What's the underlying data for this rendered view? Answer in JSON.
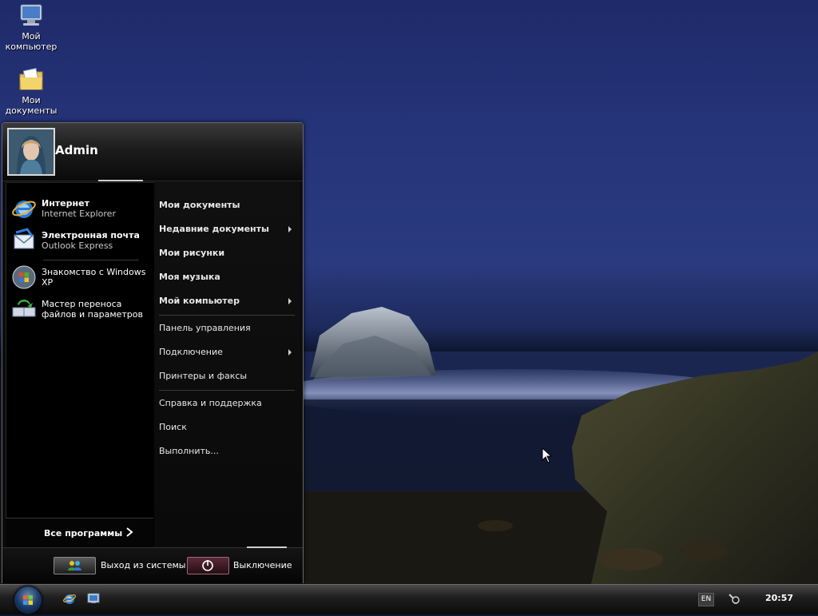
{
  "desktop": {
    "icons": [
      {
        "label": "Мой компьютер",
        "icon": "computer-icon"
      },
      {
        "label": "Мои документы",
        "icon": "documents-folder-icon"
      }
    ]
  },
  "start_menu": {
    "user": {
      "name": "Admin",
      "avatar": "user-avatar"
    },
    "pinned": [
      {
        "title": "Интернет",
        "subtitle": "Internet Explorer",
        "icon": "internet-explorer-icon"
      },
      {
        "title": "Электронная почта",
        "subtitle": "Outlook Express",
        "icon": "outlook-express-icon"
      }
    ],
    "recent": [
      {
        "label": "Знакомство с Windows XP",
        "icon": "windows-tour-icon"
      },
      {
        "label": "Мастер переноса файлов и параметров",
        "icon": "transfer-wizard-icon"
      }
    ],
    "all_programs_label": "Все программы",
    "right_items": [
      {
        "label": "Мои документы",
        "bold": true,
        "arrow": false
      },
      {
        "label": "Недавние документы",
        "bold": true,
        "arrow": true
      },
      {
        "label": "Мои рисунки",
        "bold": true,
        "arrow": false
      },
      {
        "label": "Моя музыка",
        "bold": true,
        "arrow": false
      },
      {
        "label": "Мой компьютер",
        "bold": true,
        "arrow": true
      },
      {
        "label": "Панель управления",
        "bold": false,
        "arrow": false
      },
      {
        "label": "Подключение",
        "bold": false,
        "arrow": true
      },
      {
        "label": "Принтеры и факсы",
        "bold": false,
        "arrow": false
      },
      {
        "label": "Справка и поддержка",
        "bold": false,
        "arrow": false
      },
      {
        "label": "Поиск",
        "bold": false,
        "arrow": false
      },
      {
        "label": "Выполнить...",
        "bold": false,
        "arrow": false
      }
    ],
    "footer": {
      "logoff_label": "Выход из системы",
      "shutdown_label": "Выключение"
    }
  },
  "taskbar": {
    "quick_launch": [
      "internet-explorer-icon",
      "show-desktop-icon"
    ],
    "tray": {
      "language": "EN",
      "clock": "20:57"
    }
  },
  "colors": {
    "menu_bg": "#0c0c0c",
    "accent": "#cfcfcf",
    "wallpaper_sky": "#26357a"
  }
}
